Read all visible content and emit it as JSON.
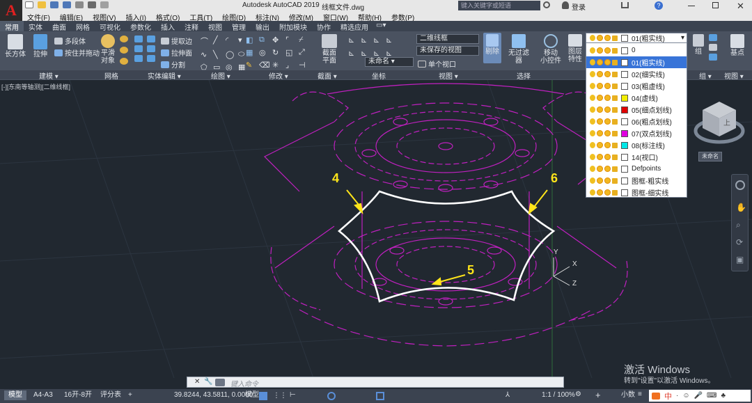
{
  "app": {
    "title": "Autodesk AutoCAD 2019",
    "file": "线框文件.dwg",
    "search_placeholder": "键入关键字或短语",
    "login": "登录"
  },
  "menu": [
    "文件(F)",
    "编辑(E)",
    "视图(V)",
    "插入(I)",
    "格式(O)",
    "工具(T)",
    "绘图(D)",
    "标注(N)",
    "修改(M)",
    "窗口(W)",
    "帮助(H)",
    "参数(P)"
  ],
  "tabs": [
    "常用",
    "实体",
    "曲面",
    "网格",
    "可视化",
    "参数化",
    "插入",
    "注释",
    "视图",
    "管理",
    "输出",
    "附加模块",
    "协作",
    "精选应用"
  ],
  "ribbon": {
    "box": "长方体",
    "extrude": "拉伸",
    "polysolid": "多段体",
    "presspull": "按住并拖动",
    "smooth_line1": "平滑",
    "smooth_line2": "对象",
    "extract_edges": "提取边",
    "extrude_face": "拉伸面",
    "separate": "分割",
    "section_line1": "截面",
    "section_line2": "平面",
    "unnamed_combo": "未命名",
    "visual_style": "二维线框",
    "saved_view": "未保存的视图",
    "viewport": "单个视口",
    "cull": "剔除",
    "no_filter": "无过滤器",
    "gizmo_line1": "移动",
    "gizmo_line2": "小控件",
    "layer_props_line1": "图层",
    "layer_props_line2": "特性",
    "group": "组",
    "base": "基点"
  },
  "panels": {
    "modeling": "建模 ▾",
    "mesh": "网格",
    "solid_edit": "实体编辑 ▾",
    "draw": "绘图 ▾",
    "modify": "修改 ▾",
    "section": "截面 ▾",
    "coordinates": "坐标",
    "view": "视图 ▾",
    "selection": "选择",
    "group": "组 ▾",
    "view2": "视图 ▾"
  },
  "viewport_label": "[-][东南等轴测][二维线框]",
  "layer_dropdown": {
    "current": "01(粗实线)",
    "items": [
      {
        "name": "0",
        "color": "#ffffff"
      },
      {
        "name": "01(粗实线)",
        "color": "#ffffff",
        "selected": true
      },
      {
        "name": "02(细实线)",
        "color": "#ffffff"
      },
      {
        "name": "03(粗虚线)",
        "color": "#ffffff"
      },
      {
        "name": "04(虚线)",
        "color": "#f2ee00"
      },
      {
        "name": "05(细点划线)",
        "color": "#e00000"
      },
      {
        "name": "06(粗点划线)",
        "color": "#ffffff"
      },
      {
        "name": "07(双点划线)",
        "color": "#e000e0"
      },
      {
        "name": "08(标注线)",
        "color": "#00e8e8"
      },
      {
        "name": "14(视口)",
        "color": "#ffffff"
      },
      {
        "name": "Defpoints",
        "color": "#ffffff"
      },
      {
        "name": "图框-粗实线",
        "color": "#ffffff"
      },
      {
        "name": "图框-细实线",
        "color": "#ffffff"
      }
    ]
  },
  "callouts": [
    "4",
    "5",
    "6"
  ],
  "viewcube": {
    "face": "上",
    "label": "未命名"
  },
  "ucs": {
    "x": "X",
    "y": "Y",
    "z": "Z"
  },
  "command": {
    "placeholder": "键入命令"
  },
  "status": {
    "tabs": [
      "模型",
      "A4-A3",
      "16开-8开",
      "评分表"
    ],
    "coords": "39.8244, 43.5811, 0.0000",
    "model": "模型",
    "scale": "1:1 / 100%",
    "decimal": "小数",
    "ime": "中"
  },
  "watermark": {
    "line1": "激活 Windows",
    "line2": "转到\"设置\"以激活 Windows。"
  }
}
